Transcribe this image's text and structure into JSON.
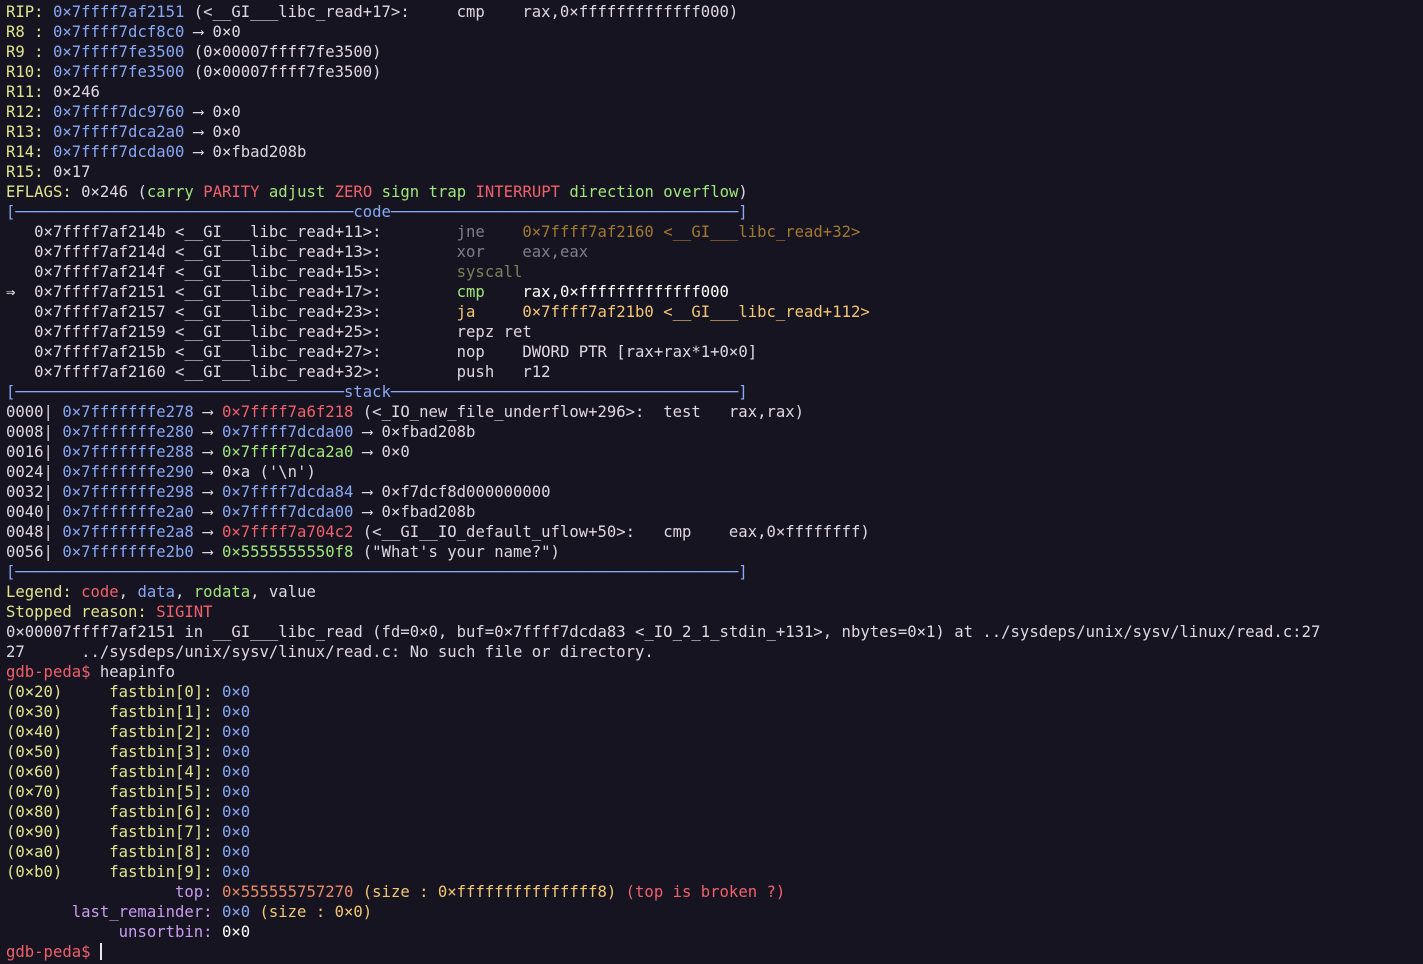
{
  "colors": {
    "background": "#171421",
    "register": "#e0e58c",
    "address": "#86a8f5",
    "code": "#f0606a",
    "rodata": "#9fe878",
    "value": "#ddd9e2",
    "prompt": "#f0606a"
  },
  "registers": [
    {
      "name": "RIP:",
      "value": "0×7ffff7af2151",
      "rest": " (<__GI___libc_read+17>:     cmp    rax,0×fffffffffffff000)"
    },
    {
      "name": "R8 :",
      "value": "0×7ffff7dcf8c0",
      "rest": " ⟶ 0×0"
    },
    {
      "name": "R9 :",
      "value": "0×7ffff7fe3500",
      "rest": " (0×00007ffff7fe3500)"
    },
    {
      "name": "R10:",
      "value": "0×7ffff7fe3500",
      "rest": " (0×00007ffff7fe3500)"
    },
    {
      "name": "R11:",
      "value": "",
      "rest": "0×246"
    },
    {
      "name": "R12:",
      "value": "0×7ffff7dc9760",
      "rest": " ⟶ 0×0"
    },
    {
      "name": "R13:",
      "value": "0×7ffff7dca2a0",
      "rest": " ⟶ 0×0"
    },
    {
      "name": "R14:",
      "value": "0×7ffff7dcda00",
      "rest": " ⟶ 0×fbad208b"
    },
    {
      "name": "R15:",
      "value": "",
      "rest": "0×17"
    }
  ],
  "eflags": {
    "label": "EFLAGS:",
    "value": "0×246",
    "open": "(",
    "close": ")",
    "flags": [
      "carry",
      "PARITY",
      "adjust",
      "ZERO",
      "sign",
      "trap",
      "INTERRUPT",
      "direction",
      "overflow"
    ]
  },
  "rules": {
    "code": "[────────────────────────────────────code─────────────────────────────────────]",
    "stack": "[───────────────────────────────────stack─────────────────────────────────────]",
    "end": "[─────────────────────────────────────────────────────────────────────────────]"
  },
  "code_lines": [
    {
      "marker": "  ",
      "addr": "0×7ffff7af214b",
      "sym": " <__GI___libc_read+11>:",
      "gap": "        ",
      "mnem": "jne   ",
      "ops": " 0×7ffff7af2160 <__GI___libc_read+32>",
      "style": "past"
    },
    {
      "marker": "  ",
      "addr": "0×7ffff7af214d",
      "sym": " <__GI___libc_read+13>:",
      "gap": "        ",
      "mnem": "xor   ",
      "ops": " eax,eax",
      "style": "past"
    },
    {
      "marker": "  ",
      "addr": "0×7ffff7af214f",
      "sym": " <__GI___libc_read+15>:",
      "gap": "        ",
      "mnem": "syscall",
      "ops": "",
      "style": "syscall"
    },
    {
      "marker": "⇒ ",
      "addr": "0×7ffff7af2151",
      "sym": " <__GI___libc_read+17>:",
      "gap": "        ",
      "mnem": "cmp   ",
      "ops": " rax,0×fffffffffffff000",
      "style": "current"
    },
    {
      "marker": "  ",
      "addr": "0×7ffff7af2157",
      "sym": " <__GI___libc_read+23>:",
      "gap": "        ",
      "mnem": "ja    ",
      "ops": " 0×7ffff7af21b0 <__GI___libc_read+112>",
      "style": "jump"
    },
    {
      "marker": "  ",
      "addr": "0×7ffff7af2159",
      "sym": " <__GI___libc_read+25>:",
      "gap": "        ",
      "mnem": "repz",
      "ops": " ret",
      "style": "next"
    },
    {
      "marker": "  ",
      "addr": "0×7ffff7af215b",
      "sym": " <__GI___libc_read+27>:",
      "gap": "        ",
      "mnem": "nop   ",
      "ops": " DWORD PTR [rax+rax*1+0×0]",
      "style": "next"
    },
    {
      "marker": "  ",
      "addr": "0×7ffff7af2160",
      "sym": " <__GI___libc_read+32>:",
      "gap": "        ",
      "mnem": "push  ",
      "ops": " r12",
      "style": "next"
    }
  ],
  "stack_lines": [
    {
      "off": "0000|",
      "addr": "0×7fffffffe278",
      "arrow": " ⟶ ",
      "val": "0×7ffff7a6f218",
      "kind": "code",
      "rest": " (<_IO_new_file_underflow+296>:  test   rax,rax)"
    },
    {
      "off": "0008|",
      "addr": "0×7fffffffe280",
      "arrow": " ⟶ ",
      "val": "0×7ffff7dcda00",
      "kind": "data",
      "rest": " ⟶ 0×fbad208b"
    },
    {
      "off": "0016|",
      "addr": "0×7fffffffe288",
      "arrow": " ⟶ ",
      "val": "0×7ffff7dca2a0",
      "kind": "rodata",
      "rest": " ⟶ 0×0"
    },
    {
      "off": "0024|",
      "addr": "0×7fffffffe290",
      "arrow": " ⟶ ",
      "val": "0×a ('\\n')",
      "kind": "value",
      "rest": ""
    },
    {
      "off": "0032|",
      "addr": "0×7fffffffe298",
      "arrow": " ⟶ ",
      "val": "0×7ffff7dcda84",
      "kind": "data",
      "rest": " ⟶ 0×f7dcf8d000000000"
    },
    {
      "off": "0040|",
      "addr": "0×7fffffffe2a0",
      "arrow": " ⟶ ",
      "val": "0×7ffff7dcda00",
      "kind": "data",
      "rest": " ⟶ 0×fbad208b"
    },
    {
      "off": "0048|",
      "addr": "0×7fffffffe2a8",
      "arrow": " ⟶ ",
      "val": "0×7ffff7a704c2",
      "kind": "code",
      "rest": " (<__GI__IO_default_uflow+50>:   cmp    eax,0×ffffffff)"
    },
    {
      "off": "0056|",
      "addr": "0×7fffffffe2b0",
      "arrow": " ⟶ ",
      "val": "0×5555555550f8",
      "kind": "rodata",
      "rest": " (\"What's your name?\")"
    }
  ],
  "legend": {
    "label": "Legend: ",
    "code": "code",
    "data": "data",
    "rodata": "rodata",
    "value": "value",
    "sep": ", "
  },
  "stopped": {
    "label": "Stopped reason: ",
    "reason": "SIGINT"
  },
  "location_line": "0×00007ffff7af2151 in __GI___libc_read (fd=0×0, buf=0×7ffff7dcda83 <_IO_2_1_stdin_+131>, nbytes=0×1) at ../sysdeps/unix/sysv/linux/read.c:27",
  "missing_line": "27      ../sysdeps/unix/sysv/linux/read.c: No such file or directory.",
  "prompt": "gdb-peda$",
  "command": "heapinfo",
  "fastbins": [
    {
      "size": "(0×20)",
      "name": "fastbin[0]:",
      "value": "0×0"
    },
    {
      "size": "(0×30)",
      "name": "fastbin[1]:",
      "value": "0×0"
    },
    {
      "size": "(0×40)",
      "name": "fastbin[2]:",
      "value": "0×0"
    },
    {
      "size": "(0×50)",
      "name": "fastbin[3]:",
      "value": "0×0"
    },
    {
      "size": "(0×60)",
      "name": "fastbin[4]:",
      "value": "0×0"
    },
    {
      "size": "(0×70)",
      "name": "fastbin[5]:",
      "value": "0×0"
    },
    {
      "size": "(0×80)",
      "name": "fastbin[6]:",
      "value": "0×0"
    },
    {
      "size": "(0×90)",
      "name": "fastbin[7]:",
      "value": "0×0"
    },
    {
      "size": "(0×a0)",
      "name": "fastbin[8]:",
      "value": "0×0"
    },
    {
      "size": "(0×b0)",
      "name": "fastbin[9]:",
      "value": "0×0"
    }
  ],
  "top": {
    "label": "top:",
    "addr": "0×555555757270",
    "size": "(size : 0×fffffffffffffff8)",
    "note": "(top is broken ?)"
  },
  "last_remainder": {
    "label": "last_remainder:",
    "addr": "0×0",
    "size": "(size : 0×0)"
  },
  "unsortbin": {
    "label": "unsortbin:",
    "value": "0×0"
  }
}
